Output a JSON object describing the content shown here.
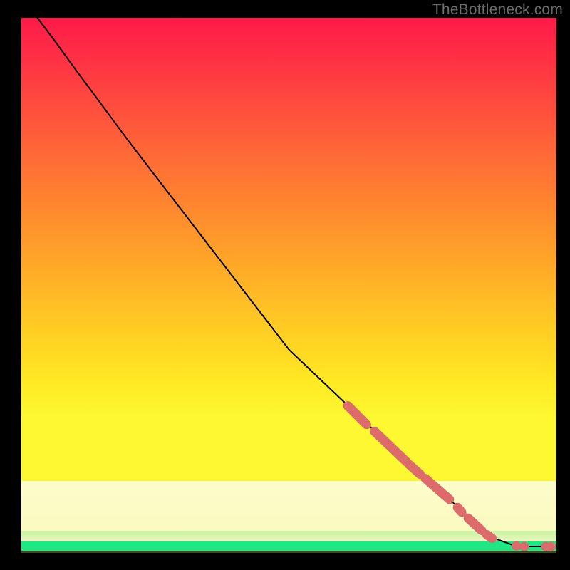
{
  "watermark": "TheBottleneck.com",
  "colors": {
    "marker": "#dd6b6b",
    "marker_stroke": "#b54f4f",
    "line": "#000000"
  },
  "chart_data": {
    "type": "line",
    "title": "",
    "xlabel": "",
    "ylabel": "",
    "xlim": [
      0,
      100
    ],
    "ylim": [
      0,
      100
    ],
    "note": "Axes are unlabeled in the source image; values below are normalized 0–100 estimates read from pixel positions.",
    "curve": [
      {
        "x": 3.0,
        "y": 100.0
      },
      {
        "x": 6.0,
        "y": 96.0
      },
      {
        "x": 10.0,
        "y": 90.5
      },
      {
        "x": 20.0,
        "y": 77.0
      },
      {
        "x": 30.0,
        "y": 64.0
      },
      {
        "x": 40.0,
        "y": 51.0
      },
      {
        "x": 50.0,
        "y": 38.0
      },
      {
        "x": 60.0,
        "y": 28.5
      },
      {
        "x": 70.0,
        "y": 19.0
      },
      {
        "x": 80.0,
        "y": 10.0
      },
      {
        "x": 85.0,
        "y": 5.5
      },
      {
        "x": 89.0,
        "y": 2.5
      },
      {
        "x": 92.0,
        "y": 1.4
      },
      {
        "x": 95.0,
        "y": 1.2
      },
      {
        "x": 98.0,
        "y": 1.2
      },
      {
        "x": 100.0,
        "y": 1.2
      }
    ],
    "marker_segments": [
      {
        "x0": 61.0,
        "y0": 27.5,
        "x1": 64.5,
        "y1": 24.0
      },
      {
        "x0": 66.0,
        "y0": 22.7,
        "x1": 72.0,
        "y1": 17.0
      },
      {
        "x0": 72.5,
        "y0": 16.5,
        "x1": 74.5,
        "y1": 14.7
      },
      {
        "x0": 75.5,
        "y0": 13.9,
        "x1": 80.0,
        "y1": 10.0
      },
      {
        "x0": 81.5,
        "y0": 8.5,
        "x1": 82.3,
        "y1": 7.6
      },
      {
        "x0": 83.5,
        "y0": 6.5,
        "x1": 86.0,
        "y1": 4.2
      },
      {
        "x0": 87.0,
        "y0": 3.4,
        "x1": 88.0,
        "y1": 2.7
      }
    ],
    "marker_points": [
      {
        "x": 92.5,
        "y": 1.3
      },
      {
        "x": 94.0,
        "y": 1.2
      },
      {
        "x": 98.0,
        "y": 1.2
      },
      {
        "x": 99.0,
        "y": 1.2
      }
    ]
  }
}
